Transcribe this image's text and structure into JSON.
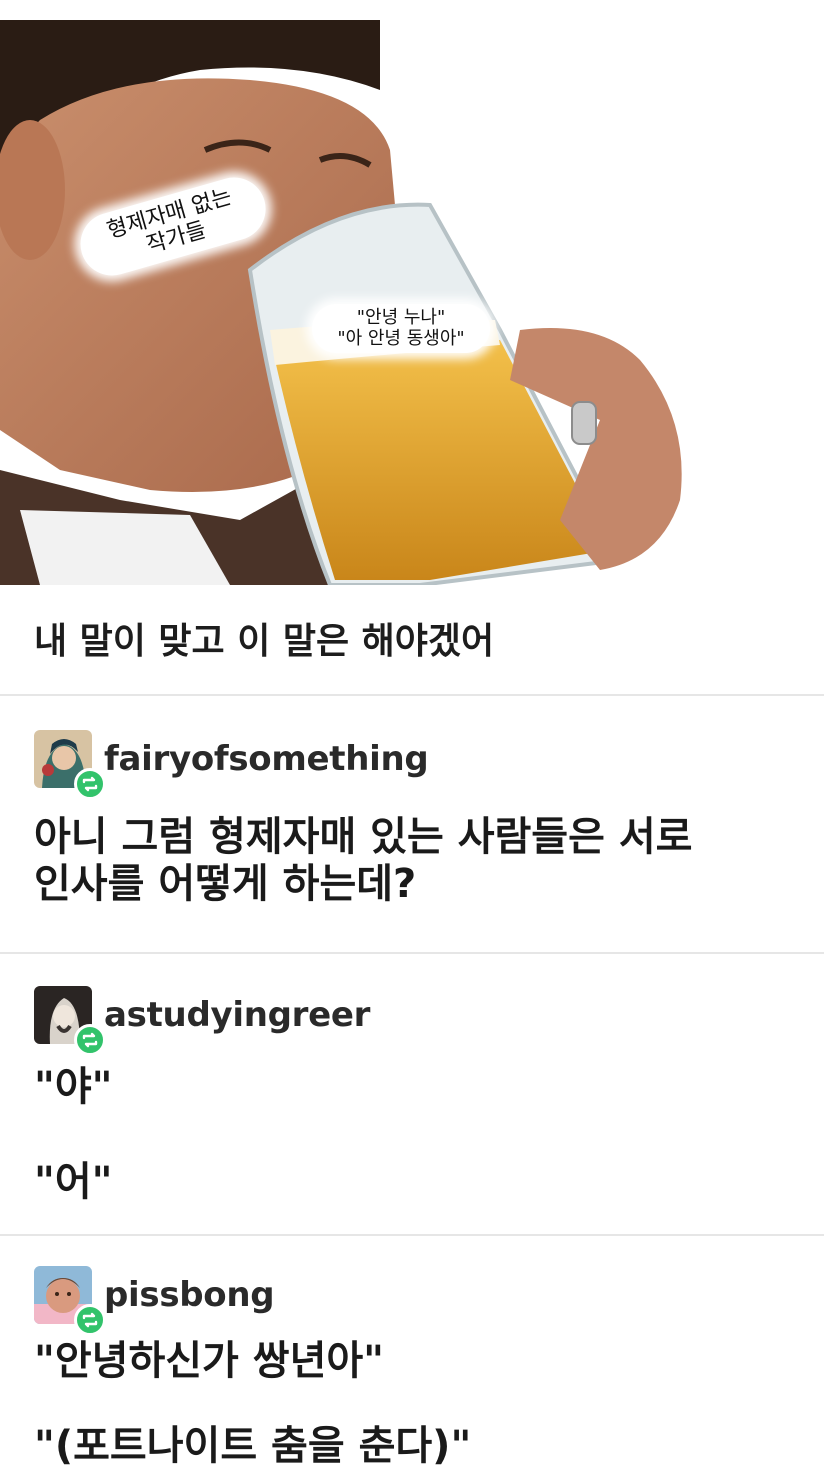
{
  "meme": {
    "bubble_siblings": "형제자매 없는\n작가들",
    "bubble_greeting": "\"안녕 누나\"\n\"아 안녕 동생아\""
  },
  "caption": "내 말이 맞고 이 말은 해야겠어",
  "posts": [
    {
      "username": "fairyofsomething",
      "lines": [
        "아니 그럼 형제자매 있는 사람들은 서로",
        "인사를 어떻게 하는데?"
      ]
    },
    {
      "username": "astudyingreer",
      "lines": [
        "\"야\"",
        "\"어\""
      ]
    },
    {
      "username": "pissbong",
      "lines": [
        "\"안녕하신가 쌍년아\"",
        "\"(포트나이트 춤을 춘다)\""
      ]
    }
  ],
  "colors": {
    "reblog_badge": "#32c36b",
    "divider": "#e6e6e6",
    "beer": "#e2a52a"
  },
  "icons": [
    "reblog-icon"
  ]
}
